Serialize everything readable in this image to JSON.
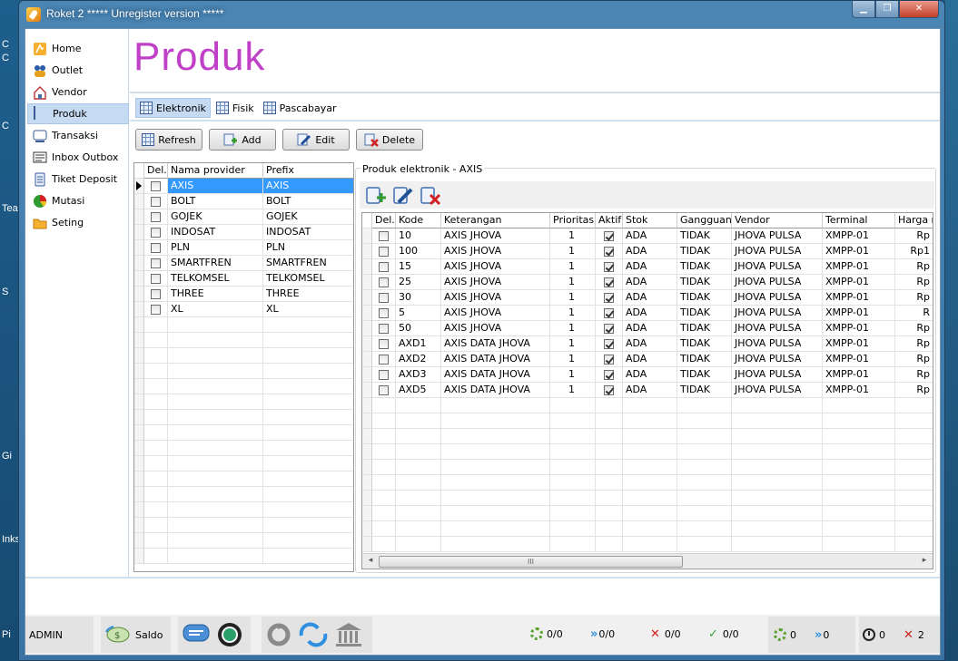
{
  "window": {
    "title": "Roket 2 ***** Unregister version *****",
    "min_label": "▁",
    "max_label": "❐",
    "close_label": "✕"
  },
  "desktop_labels": [
    "C",
    "C",
    "C",
    "Tea",
    "S",
    "Gi",
    "Inks",
    "Pi"
  ],
  "sidebar": {
    "items": [
      {
        "label": "Home",
        "icon": "home-icon"
      },
      {
        "label": "Outlet",
        "icon": "outlet-icon"
      },
      {
        "label": "Vendor",
        "icon": "vendor-icon"
      },
      {
        "label": "Produk",
        "icon": "grid-icon",
        "active": true
      },
      {
        "label": "Transaksi",
        "icon": "transaksi-icon"
      },
      {
        "label": "Inbox Outbox",
        "icon": "inbox-icon"
      },
      {
        "label": "Tiket Deposit",
        "icon": "tiket-icon"
      },
      {
        "label": "Mutasi",
        "icon": "pie-icon"
      },
      {
        "label": "Seting",
        "icon": "folder-icon"
      }
    ]
  },
  "page": {
    "title": "Produk"
  },
  "tabs": [
    {
      "label": "Elektronik",
      "active": true
    },
    {
      "label": "Fisik"
    },
    {
      "label": "Pascabayar"
    }
  ],
  "toolbar": {
    "refresh": "Refresh",
    "add": "Add",
    "edit": "Edit",
    "delete": "Delete"
  },
  "providers": {
    "columns": [
      "Del.",
      "Nama provider",
      "Prefix"
    ],
    "rows": [
      {
        "name": "AXIS",
        "prefix": "AXIS",
        "selected": true
      },
      {
        "name": "BOLT",
        "prefix": "BOLT"
      },
      {
        "name": "GOJEK",
        "prefix": "GOJEK"
      },
      {
        "name": "INDOSAT",
        "prefix": "INDOSAT"
      },
      {
        "name": "PLN",
        "prefix": "PLN"
      },
      {
        "name": "SMARTFREN",
        "prefix": "SMARTFREN"
      },
      {
        "name": "TELKOMSEL",
        "prefix": "TELKOMSEL"
      },
      {
        "name": "THREE",
        "prefix": "THREE"
      },
      {
        "name": "XL",
        "prefix": "XL"
      }
    ]
  },
  "products": {
    "group_title": "Produk elektronik - AXIS",
    "columns": [
      "Del.",
      "Kode",
      "Keterangan",
      "Prioritas",
      "Aktif",
      "Stok",
      "Gangguan",
      "Vendor",
      "Terminal",
      "Harga r"
    ],
    "rows": [
      {
        "kode": "10",
        "ket": "AXIS JHOVA",
        "prio": "1",
        "stok": "ADA",
        "gang": "TIDAK",
        "vendor": "JHOVA PULSA",
        "term": "XMPP-01",
        "harga": "Rp"
      },
      {
        "kode": "100",
        "ket": "AXIS JHOVA",
        "prio": "1",
        "stok": "ADA",
        "gang": "TIDAK",
        "vendor": "JHOVA PULSA",
        "term": "XMPP-01",
        "harga": "Rp1"
      },
      {
        "kode": "15",
        "ket": "AXIS JHOVA",
        "prio": "1",
        "stok": "ADA",
        "gang": "TIDAK",
        "vendor": "JHOVA PULSA",
        "term": "XMPP-01",
        "harga": "Rp"
      },
      {
        "kode": "25",
        "ket": "AXIS JHOVA",
        "prio": "1",
        "stok": "ADA",
        "gang": "TIDAK",
        "vendor": "JHOVA PULSA",
        "term": "XMPP-01",
        "harga": "Rp"
      },
      {
        "kode": "30",
        "ket": "AXIS JHOVA",
        "prio": "1",
        "stok": "ADA",
        "gang": "TIDAK",
        "vendor": "JHOVA PULSA",
        "term": "XMPP-01",
        "harga": "Rp"
      },
      {
        "kode": "5",
        "ket": "AXIS JHOVA",
        "prio": "1",
        "stok": "ADA",
        "gang": "TIDAK",
        "vendor": "JHOVA PULSA",
        "term": "XMPP-01",
        "harga": "R"
      },
      {
        "kode": "50",
        "ket": "AXIS JHOVA",
        "prio": "1",
        "stok": "ADA",
        "gang": "TIDAK",
        "vendor": "JHOVA PULSA",
        "term": "XMPP-01",
        "harga": "Rp"
      },
      {
        "kode": "AXD1",
        "ket": "AXIS DATA JHOVA",
        "prio": "1",
        "stok": "ADA",
        "gang": "TIDAK",
        "vendor": "JHOVA PULSA",
        "term": "XMPP-01",
        "harga": "Rp"
      },
      {
        "kode": "AXD2",
        "ket": "AXIS DATA JHOVA",
        "prio": "1",
        "stok": "ADA",
        "gang": "TIDAK",
        "vendor": "JHOVA PULSA",
        "term": "XMPP-01",
        "harga": "Rp"
      },
      {
        "kode": "AXD3",
        "ket": "AXIS DATA JHOVA",
        "prio": "1",
        "stok": "ADA",
        "gang": "TIDAK",
        "vendor": "JHOVA PULSA",
        "term": "XMPP-01",
        "harga": "Rp"
      },
      {
        "kode": "AXD5",
        "ket": "AXIS DATA JHOVA",
        "prio": "1",
        "stok": "ADA",
        "gang": "TIDAK",
        "vendor": "JHOVA PULSA",
        "term": "XMPP-01",
        "harga": "Rp"
      }
    ],
    "scroll_grip": "III",
    "scroll_left": "◂",
    "scroll_right": "▸"
  },
  "statusbar": {
    "user": "ADMIN",
    "saldo": "Saldo",
    "counters": {
      "gear": "0/0",
      "forward": "0/0",
      "fail": "0/0",
      "ok": "0/0"
    },
    "counters2": {
      "gear": "0",
      "forward": "0",
      "clock": "0",
      "fail": "2"
    }
  },
  "colors": {
    "title_accent": "#c040c8",
    "selection": "#3399ff",
    "nav_active": "#c6dbf2"
  }
}
